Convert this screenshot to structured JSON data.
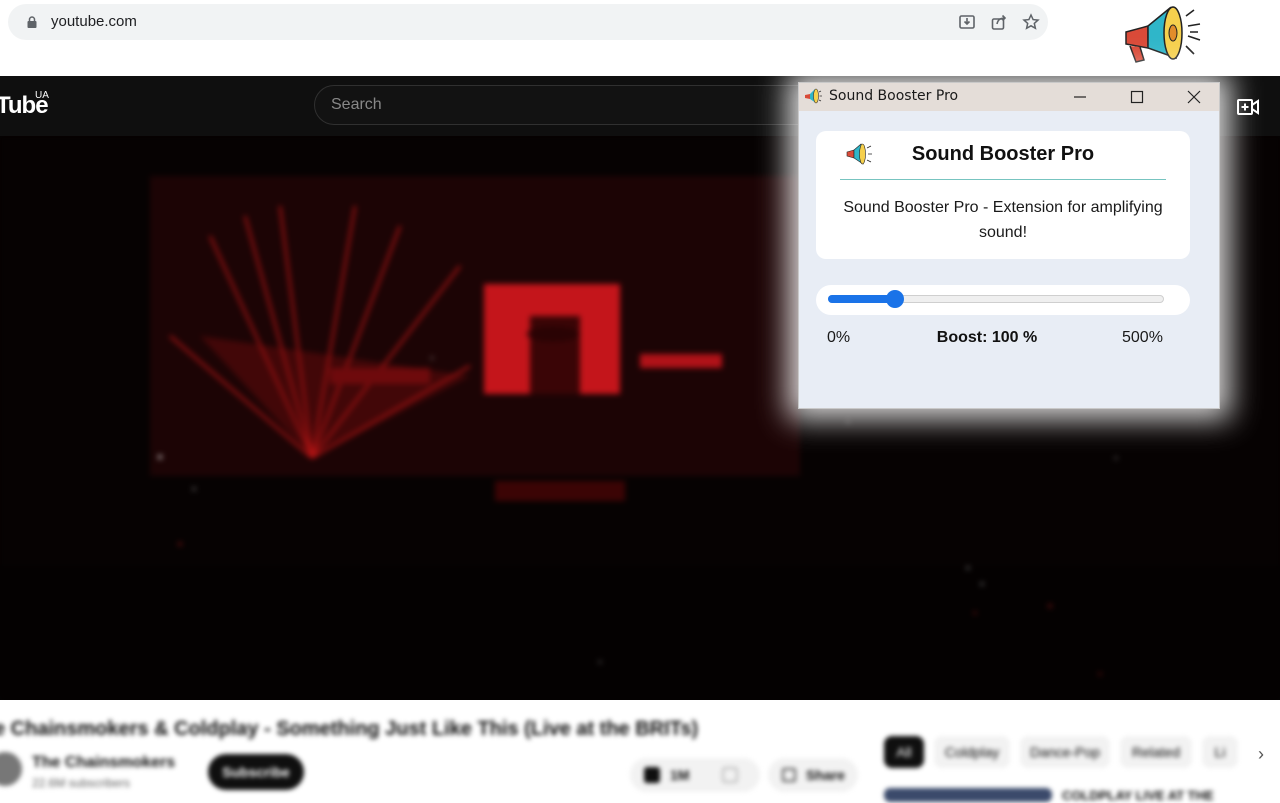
{
  "browser": {
    "url": "youtube.com",
    "icons": [
      "lock-icon",
      "install-icon",
      "share-icon",
      "bookmark-star-icon",
      "megaphone-extension-icon"
    ]
  },
  "youtube": {
    "logo_text": "Tube",
    "region": "UA",
    "search_placeholder": "Search",
    "video_title": "e Chainsmokers & Coldplay - Something Just Like This (Live at the BRITs)",
    "channel_name": "The Chainsmokers",
    "channel_subs": "22.6M subscribers",
    "subscribe_label": "Subscribe",
    "like_count": "1M",
    "share_label": "Share",
    "chips": [
      "All",
      "Coldplay",
      "Dance-Pop",
      "Related",
      "Li"
    ],
    "recommendation_title": "COLDPLAY LIVE AT THE"
  },
  "popup": {
    "window_title": "Sound Booster Pro",
    "heading": "Sound Booster Pro",
    "description": "Sound Booster Pro - Extension for amplifying sound!",
    "slider": {
      "min_label": "0%",
      "max_label": "500%",
      "boost_label": "Boost: 100 %",
      "min": 0,
      "max": 500,
      "value": 100
    },
    "colors": {
      "accent": "#1a73e8",
      "divider": "#77c4c0",
      "window_bg": "#e8edf5",
      "titlebar_bg": "#e4ddd8"
    }
  }
}
